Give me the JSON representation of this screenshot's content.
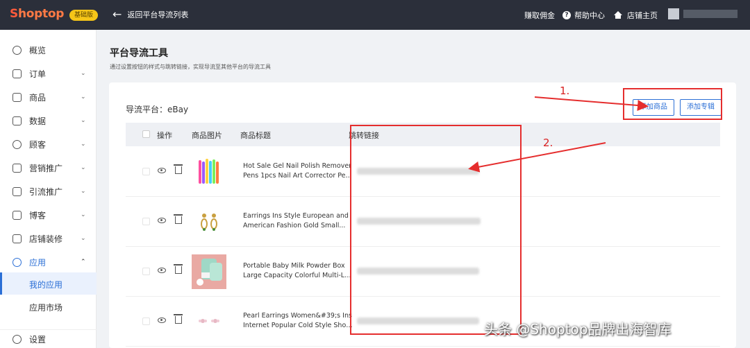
{
  "topbar": {
    "logo": "Shoptop",
    "badge": "基础版",
    "back_label": "返回平台导流列表",
    "nav": [
      "赚取佣金",
      "帮助中心",
      "店铺主页"
    ]
  },
  "sidebar": {
    "items": [
      {
        "label": "概览",
        "icon": "dashboard-icon",
        "chevron": false
      },
      {
        "label": "订单",
        "icon": "order-icon",
        "chevron": true
      },
      {
        "label": "商品",
        "icon": "product-icon",
        "chevron": true
      },
      {
        "label": "数据",
        "icon": "data-icon",
        "chevron": true
      },
      {
        "label": "顾客",
        "icon": "customer-icon",
        "chevron": true
      },
      {
        "label": "营销推广",
        "icon": "marketing-icon",
        "chevron": true
      },
      {
        "label": "引流推广",
        "icon": "traffic-icon",
        "chevron": true
      },
      {
        "label": "博客",
        "icon": "blog-icon",
        "chevron": true
      },
      {
        "label": "店铺装修",
        "icon": "store-design-icon",
        "chevron": true
      },
      {
        "label": "应用",
        "icon": "apps-icon",
        "chevron": true
      }
    ],
    "sub_items": [
      "我的应用",
      "应用市场"
    ],
    "settings_label": "设置"
  },
  "main": {
    "title": "平台导流工具",
    "description": "通过设置按钮的样式与跳转链接，实现导流至其他平台的导流工具",
    "platform_label": "导流平台：eBay",
    "buttons": {
      "add_product": "添加商品",
      "add_collection": "添加专辑"
    },
    "columns": [
      "操作",
      "商品图片",
      "商品标题",
      "跳转链接"
    ],
    "rows": [
      {
        "title_line1": "Hot Sale Gel Nail Polish Remover",
        "title_line2": "Pens 1pcs Nail Art Corrector Pen..."
      },
      {
        "title_line1": "Earrings Ins Style European and",
        "title_line2": "American Fashion Gold Small..."
      },
      {
        "title_line1": "Portable Baby Milk Powder Box",
        "title_line2": "Large Capacity Colorful Multi-Lay..."
      },
      {
        "title_line1": "Pearl Earrings Women&#39;s Ins",
        "title_line2": "Internet Popular Cold Style Short..."
      }
    ]
  },
  "annotations": {
    "step1": "1.",
    "step2": "2."
  },
  "watermark": "头条 @Shoptop品牌出海智库",
  "colors": {
    "accent": "#2b6fd6",
    "topbar": "#2b2f3a",
    "annotation": "#e52d2d"
  }
}
